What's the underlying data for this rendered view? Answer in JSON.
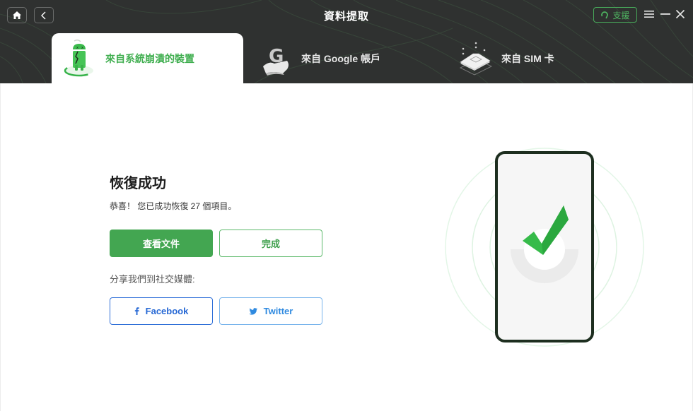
{
  "window": {
    "title": "資料提取",
    "support_label": "支援",
    "home_icon": "home-icon",
    "back_icon": "chevron-left-icon",
    "menu_icon": "hamburger-menu-icon",
    "minimize_icon": "minimize-icon",
    "close_icon": "close-icon"
  },
  "tabs": [
    {
      "label": "來自系統崩潰的裝置",
      "icon": "broken-android-icon",
      "active": true
    },
    {
      "label": "來自 Google 帳戶",
      "icon": "google-account-icon",
      "active": false
    },
    {
      "label": "來自 SIM 卡",
      "icon": "sim-card-icon",
      "active": false
    }
  ],
  "main": {
    "title": "恢復成功",
    "message": "恭喜！ 您已成功恢復 27 個項目。",
    "recovered_count": 27,
    "view_files_label": "查看文件",
    "done_label": "完成",
    "share_label": "分享我們到社交媒體:",
    "share": [
      {
        "label": "Facebook",
        "icon": "facebook-icon"
      },
      {
        "label": "Twitter",
        "icon": "twitter-icon"
      }
    ]
  },
  "colors": {
    "accent": "#43a651",
    "header_bg": "#2f3130",
    "facebook": "#2567d4",
    "twitter": "#2f8ae0"
  }
}
